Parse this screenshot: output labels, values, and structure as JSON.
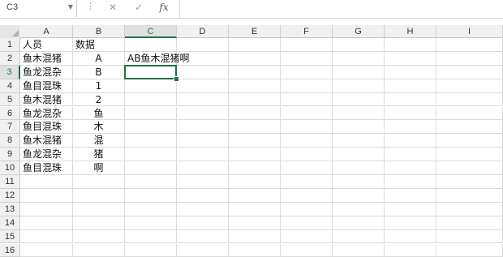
{
  "formula_bar": {
    "name_box": "C3",
    "cancel_icon": "✕",
    "enter_icon": "✓",
    "fx_label": "fx",
    "formula_value": ""
  },
  "columns": [
    "A",
    "B",
    "C",
    "D",
    "E",
    "F",
    "G",
    "H",
    "I"
  ],
  "rows": [
    "1",
    "2",
    "3",
    "4",
    "5",
    "6",
    "7",
    "8",
    "9",
    "10",
    "11",
    "12",
    "13",
    "14",
    "15",
    "16"
  ],
  "cells": {
    "A1": "人员",
    "B1": "数据",
    "A2": "鱼木混猪",
    "B2": "A",
    "C2": "AB鱼木混猪啊",
    "A3": "鱼龙混杂",
    "B3": "B",
    "A4": "鱼目混珠",
    "B4": "1",
    "A5": "鱼木混猪",
    "B5": "2",
    "A6": "鱼龙混杂",
    "B6": "鱼",
    "A7": "鱼目混珠",
    "B7": "木",
    "A8": "鱼木混猪",
    "B8": "混",
    "A9": "鱼龙混杂",
    "B9": "猪",
    "A10": "鱼目混珠",
    "B10": "啊"
  },
  "selection": {
    "cell": "C3",
    "accent": "#217346"
  }
}
